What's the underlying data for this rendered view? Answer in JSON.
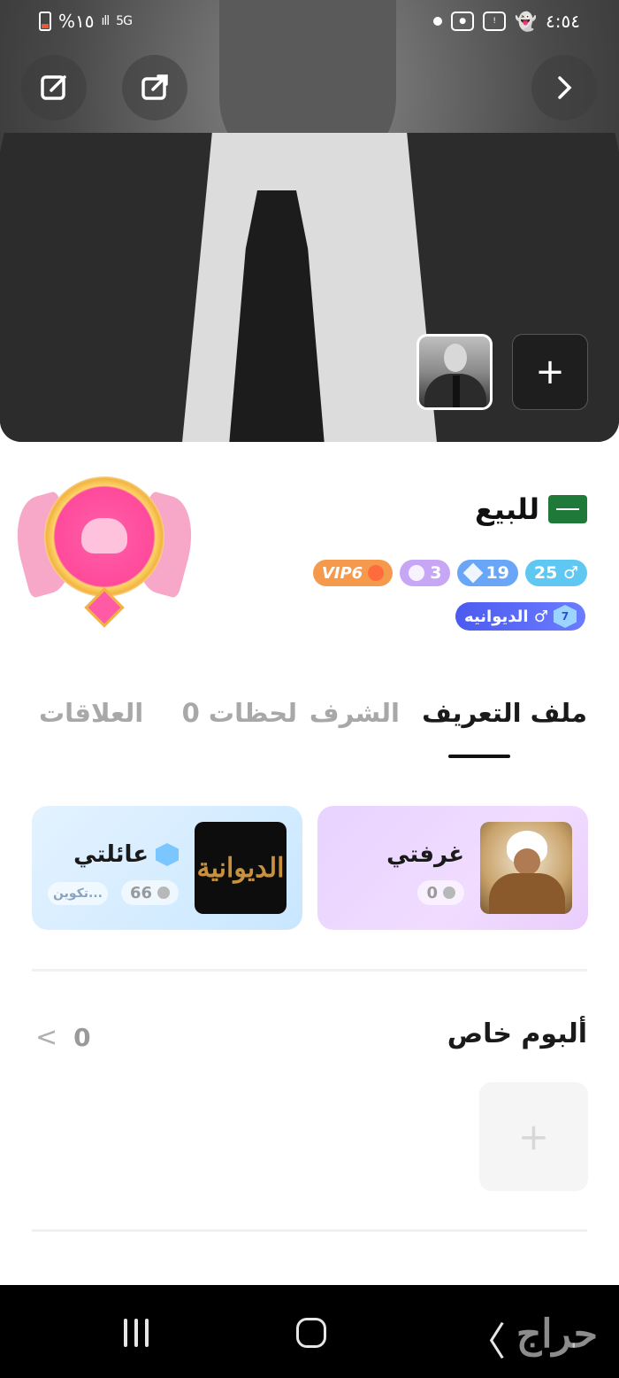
{
  "status_bar": {
    "battery": "%١٥",
    "network": "5G",
    "time": "٤:٥٤"
  },
  "header": {
    "edit_icon": "edit-icon",
    "share_icon": "share-icon",
    "forward_icon": "chevron-right-icon",
    "add_photo_label": "+"
  },
  "profile": {
    "name": "للبيع",
    "country": "Saudi Arabia",
    "badges": {
      "age": "25 ♂",
      "diamond_level": "19",
      "star_level": "3",
      "vip": "VIP6"
    },
    "family_tag": "الديوانيه ♂",
    "family_level": "7"
  },
  "tabs": [
    {
      "label": "ملف التعريف",
      "active": true
    },
    {
      "label": "الشرف",
      "active": false
    },
    {
      "label": "لحظات 0",
      "active": false
    },
    {
      "label": "العلاقات",
      "active": false
    }
  ],
  "cards": {
    "room": {
      "title": "غرفتي",
      "count": "0"
    },
    "family": {
      "title": "عائلتي",
      "count": "66",
      "extra": "تكوين...",
      "logo_text": "الديوانية"
    }
  },
  "album": {
    "title": "ألبوم خاص",
    "count": "0",
    "add_label": "+"
  },
  "navbar": {
    "watermark": "حراج"
  }
}
